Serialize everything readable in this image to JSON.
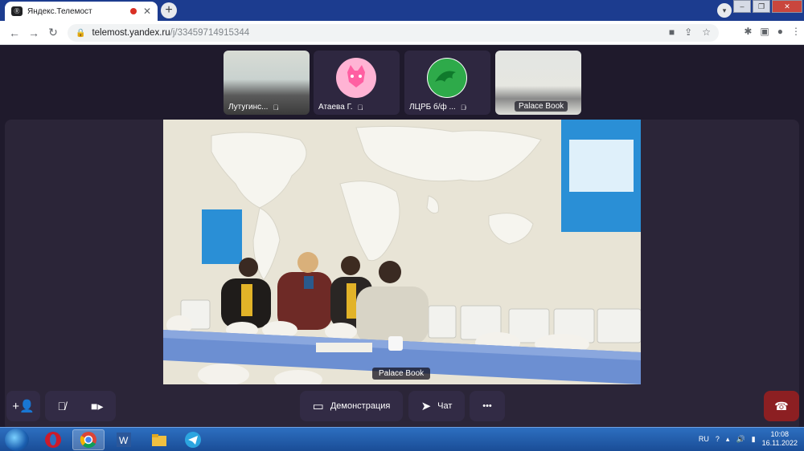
{
  "browser": {
    "tab_title": "Яндекс.Телемост",
    "favicon": "Ⓡ",
    "url_host": "telemost.yandex.ru",
    "url_path": "/j/33459714915344"
  },
  "participants": [
    {
      "name": "Лутугинс...",
      "muted": true
    },
    {
      "name": "Атаева Г.",
      "muted": true,
      "avatar_color": "#ffb3d4"
    },
    {
      "name": "ЛЦРБ б/ф ...",
      "muted": true,
      "avatar_color": "#2eaa4a"
    },
    {
      "name": "Palace Book",
      "muted": false
    }
  ],
  "main_video": {
    "speaker_name": "Palace Book"
  },
  "controls": {
    "demo_label": "Демонстрация",
    "chat_label": "Чат",
    "more_label": "•••"
  },
  "taskbar": {
    "lang": "RU",
    "time": "10:08",
    "date": "16.11.2022"
  },
  "colors": {
    "meeting_bg": "#1f1a2c",
    "control_bg": "#322b45",
    "hangup": "#8c1f22"
  }
}
